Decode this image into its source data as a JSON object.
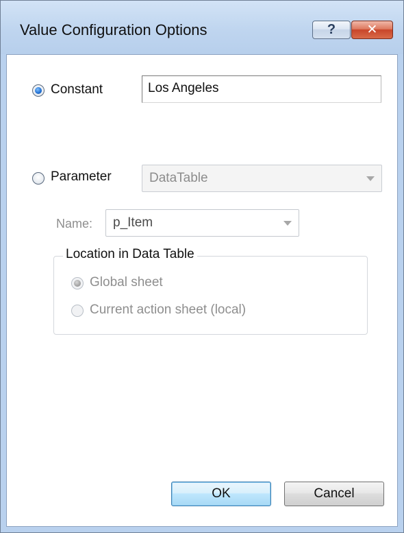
{
  "window": {
    "title": "Value Configuration Options",
    "help_label": "?",
    "close_label": "✕"
  },
  "constant": {
    "label": "Constant",
    "selected": true,
    "value": "Los Angeles"
  },
  "parameter": {
    "label": "Parameter",
    "selected": false,
    "type_value": "DataTable",
    "name_label": "Name:",
    "name_value": "p_Item"
  },
  "location": {
    "legend": "Location in Data Table",
    "options": [
      {
        "label": "Global sheet",
        "selected": true
      },
      {
        "label": "Current action sheet (local)",
        "selected": false
      }
    ]
  },
  "buttons": {
    "ok": "OK",
    "cancel": "Cancel"
  },
  "colors": {
    "title_bar": "#bfd5ef",
    "close_button": "#c8452a",
    "radio_selected": "#1f6ed1"
  }
}
